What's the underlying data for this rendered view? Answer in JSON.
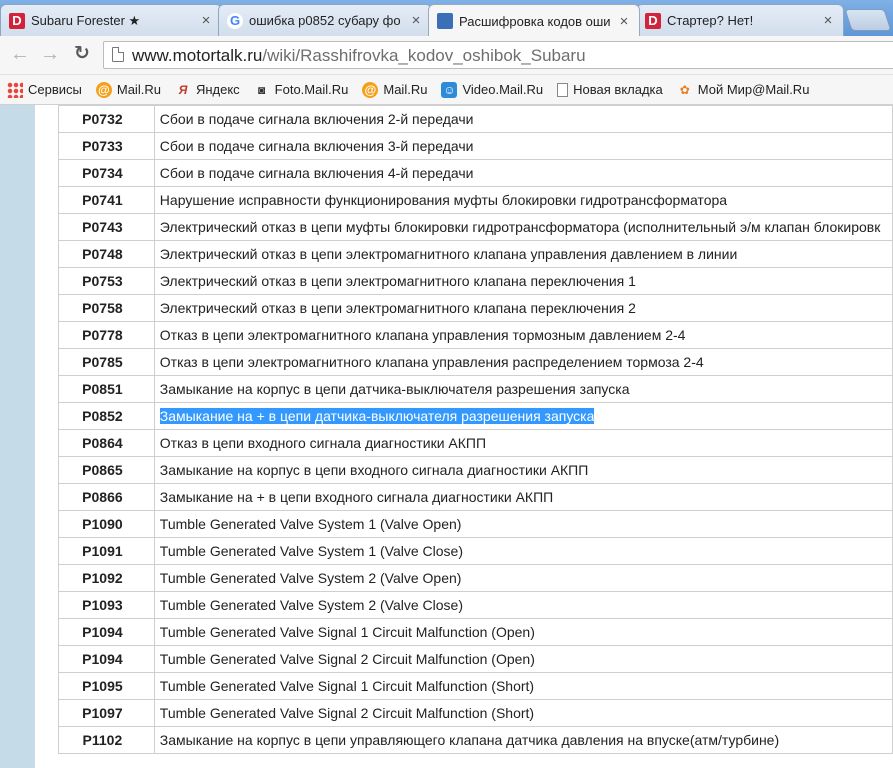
{
  "tabs": [
    {
      "title": "Subaru Forester ★",
      "favicon": "drive2-icon",
      "active": false
    },
    {
      "title": "ошибка p0852 субару фо",
      "favicon": "google-icon",
      "active": false
    },
    {
      "title": "Расшифровка кодов оши",
      "favicon": "motortalk-icon",
      "active": true
    },
    {
      "title": "Стартер? Нет!",
      "favicon": "drive2-icon",
      "active": false
    }
  ],
  "toolbar": {
    "url_host": "www.motortalk.ru",
    "url_path": "/wiki/Rasshifrovka_kodov_oshibok_Subaru"
  },
  "bookmarks": [
    {
      "label": "Сервисы",
      "icon": "apps-grid-icon"
    },
    {
      "label": "Mail.Ru",
      "icon": "mailru-icon"
    },
    {
      "label": "Яндекс",
      "icon": "yandex-icon"
    },
    {
      "label": "Foto.Mail.Ru",
      "icon": "camera-icon"
    },
    {
      "label": "Mail.Ru",
      "icon": "mailru-icon"
    },
    {
      "label": "Video.Mail.Ru",
      "icon": "video-icon"
    },
    {
      "label": "Новая вкладка",
      "icon": "page-icon"
    },
    {
      "label": "Мой Мир@Mail.Ru",
      "icon": "moimir-icon"
    }
  ],
  "codes": [
    {
      "code": "P0732",
      "desc": "Сбои в подаче сигнала включения 2-й передачи"
    },
    {
      "code": "P0733",
      "desc": "Сбои в подаче сигнала включения 3-й передачи"
    },
    {
      "code": "P0734",
      "desc": "Сбои в подаче сигнала включения 4-й передачи"
    },
    {
      "code": "P0741",
      "desc": "Нарушение исправности функционирования муфты блокировки гидротрансформатора"
    },
    {
      "code": "P0743",
      "desc": "Электрический отказ в цепи муфты блокировки гидротрансформатора (исполнительный э/м клапан блокировк"
    },
    {
      "code": "P0748",
      "desc": "Электрический отказ в цепи электромагнитного клапана управления давлением в линии"
    },
    {
      "code": "P0753",
      "desc": "Электрический отказ в цепи электромагнитного клапана переключения 1"
    },
    {
      "code": "P0758",
      "desc": "Электрический отказ в цепи электромагнитного клапана переключения 2"
    },
    {
      "code": "P0778",
      "desc": "Отказ в цепи электромагнитного клапана управления тормозным давлением 2-4"
    },
    {
      "code": "P0785",
      "desc": "Отказ в цепи электромагнитного клапана управления распределением тормоза 2-4"
    },
    {
      "code": "P0851",
      "desc": "Замыкание на корпус в цепи датчика-выключателя разрешения запуска"
    },
    {
      "code": "P0852",
      "desc": "Замыкание на + в цепи датчика-выключателя разрешения запуска",
      "highlighted": true
    },
    {
      "code": "P0864",
      "desc": "Отказ в цепи входного сигнала диагностики АКПП"
    },
    {
      "code": "P0865",
      "desc": "Замыкание на корпус в цепи входного сигнала диагностики АКПП"
    },
    {
      "code": "P0866",
      "desc": "Замыкание на + в цепи входного сигнала диагностики АКПП"
    },
    {
      "code": "P1090",
      "desc": "Tumble Generated Valve System 1 (Valve Open)"
    },
    {
      "code": "P1091",
      "desc": "Tumble Generated Valve System 1 (Valve Close)"
    },
    {
      "code": "P1092",
      "desc": "Tumble Generated Valve System 2 (Valve Open)"
    },
    {
      "code": "P1093",
      "desc": "Tumble Generated Valve System 2 (Valve Close)"
    },
    {
      "code": "P1094",
      "desc": "Tumble Generated Valve Signal 1 Circuit Malfunction (Open)"
    },
    {
      "code": "P1094",
      "desc": "Tumble Generated Valve Signal 2 Circuit Malfunction (Open)"
    },
    {
      "code": "P1095",
      "desc": "Tumble Generated Valve Signal 1 Circuit Malfunction (Short)"
    },
    {
      "code": "P1097",
      "desc": "Tumble Generated Valve Signal 2 Circuit Malfunction (Short)"
    },
    {
      "code": "P1102",
      "desc": "Замыкание на корпус в цепи управляющего клапана датчика давления на впуске(атм/турбине)"
    }
  ],
  "colors": {
    "tabstrip": "#6fa3df",
    "selection": "#3399ff",
    "sidebar": "#c5dbe8"
  }
}
